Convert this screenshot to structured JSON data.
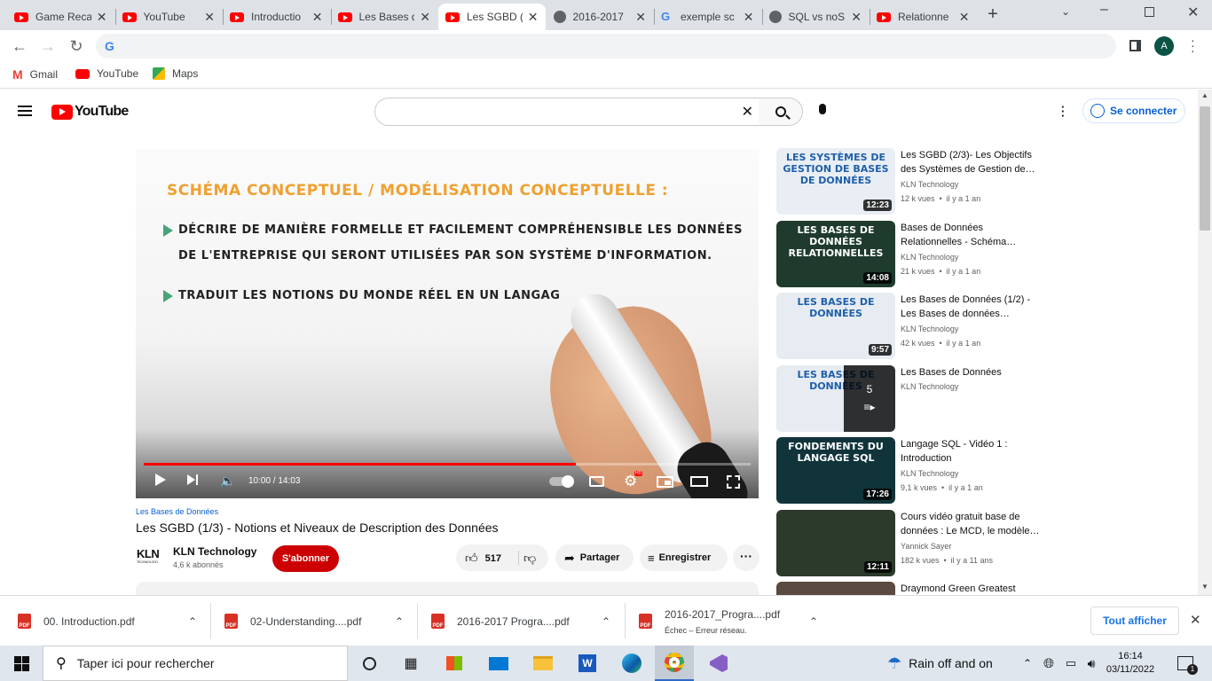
{
  "tabs": [
    {
      "title": "Game Reca",
      "kind": "yt"
    },
    {
      "title": "YouTube",
      "kind": "yt"
    },
    {
      "title": "Introductio",
      "kind": "yt"
    },
    {
      "title": "Les Bases d",
      "kind": "yt"
    },
    {
      "title": "Les SGBD (",
      "kind": "yt",
      "active": true
    },
    {
      "title": "2016-2017",
      "kind": "globe"
    },
    {
      "title": "exemple sc",
      "kind": "g"
    },
    {
      "title": "SQL vs noS",
      "kind": "globe"
    },
    {
      "title": "Relationne",
      "kind": "yt"
    }
  ],
  "toolbar": {
    "profile_initial": "A"
  },
  "bookmarks": [
    {
      "label": "Gmail"
    },
    {
      "label": "YouTube"
    },
    {
      "label": "Maps"
    }
  ],
  "yt": {
    "logo": "YouTube",
    "signin": "Se connecter",
    "video": {
      "heading": "SCHÉMA CONCEPTUEL / MODÉLISATION CONCEPTUELLE :",
      "bullet1a": "DÉCRIRE DE MANIÈRE FORMELLE ET FACILEMENT COMPRÉHENSIBLE LES DONNÉES",
      "bullet1b": "DE L'ENTREPRISE QUI SERONT UTILISÉES PAR SON SYSTÈME D'INFORMATION.",
      "bullet2": "TRADUIT LES NOTIONS DU MONDE RÉEL EN UN LANGAG",
      "time": "10:00 / 14:03",
      "progress": 0.712,
      "hd_badge": "HD"
    },
    "playlist_link": "Les Bases de Données",
    "title": "Les SGBD (1/3) - Notions et Niveaux de Description des Données",
    "channel": {
      "logo": "KLN",
      "logo_sub": "TECHNOLOGY",
      "name": "KLN Technology",
      "subs": "4,6 k abonnés"
    },
    "subscribe": "S'abonner",
    "likes": "517",
    "share": "Partager",
    "save": "Enregistrer",
    "suggestions": [
      {
        "title": "Les SGBD (2/3)- Les Objectifs des Systèmes de Gestion de…",
        "channel": "KLN Technology",
        "meta": "12 k vues  •  il y a 1 an",
        "duration": "12:23",
        "thumb": "Les Systèmes de Gestion de Bases de Données",
        "bg": "#e8eef4",
        "fg": "#1f5fa8"
      },
      {
        "title": "Bases de Données Relationnelles - Schéma…",
        "channel": "KLN Technology",
        "meta": "21 k vues  •  il y a 1 an",
        "duration": "14:08",
        "thumb": "Les Bases de Données Relationnelles",
        "bg": "#1e3b2e",
        "fg": "#ffffff"
      },
      {
        "title": "Les Bases de Données (1/2) - Les Bases de données…",
        "channel": "KLN Technology",
        "meta": "42 k vues  •  il y a 1 an",
        "duration": "9:57",
        "thumb": "Les Bases de Données",
        "bg": "#e6ecf2",
        "fg": "#1f5fa8"
      },
      {
        "title": "Les Bases de Données",
        "channel": "KLN Technology",
        "meta": "",
        "duration": "5",
        "thumb": "Les Bases de Données",
        "bg": "#e6ecf2",
        "fg": "#1f5fa8",
        "playlist": true
      },
      {
        "title": "Langage SQL - Vidéo 1 : Introduction",
        "channel": "KLN Technology",
        "meta": "9,1 k vues  •  il y a 1 an",
        "duration": "17:26",
        "thumb": "Fondements du langage SQL",
        "bg": "#10343a",
        "fg": "#ffffff"
      },
      {
        "title": "Cours vidéo gratuit base de données : Le MCD, le modèle…",
        "channel": "Yannick Sayer",
        "meta": "182 k vues  •  il y a 11 ans",
        "duration": "12:11",
        "thumb": "",
        "bg": "#2b3a2a",
        "fg": "#ffffff"
      },
      {
        "title": "Draymond Green Greatest",
        "channel": "",
        "meta": "",
        "duration": "",
        "thumb": "",
        "bg": "#5a4a40",
        "fg": "#ffffff"
      }
    ]
  },
  "downloads": [
    {
      "name": "00. Introduction.pdf",
      "sub": ""
    },
    {
      "name": "02-Understanding....pdf",
      "sub": ""
    },
    {
      "name": "2016-2017 Progra....pdf",
      "sub": ""
    },
    {
      "name": "2016-2017_Progra....pdf",
      "sub": "Échec – Erreur réseau."
    }
  ],
  "show_all": "Tout afficher",
  "taskbar": {
    "search": "Taper ici pour rechercher",
    "weather": "Rain off and on",
    "time": "16:14",
    "date": "03/11/2022",
    "notif": "1"
  }
}
